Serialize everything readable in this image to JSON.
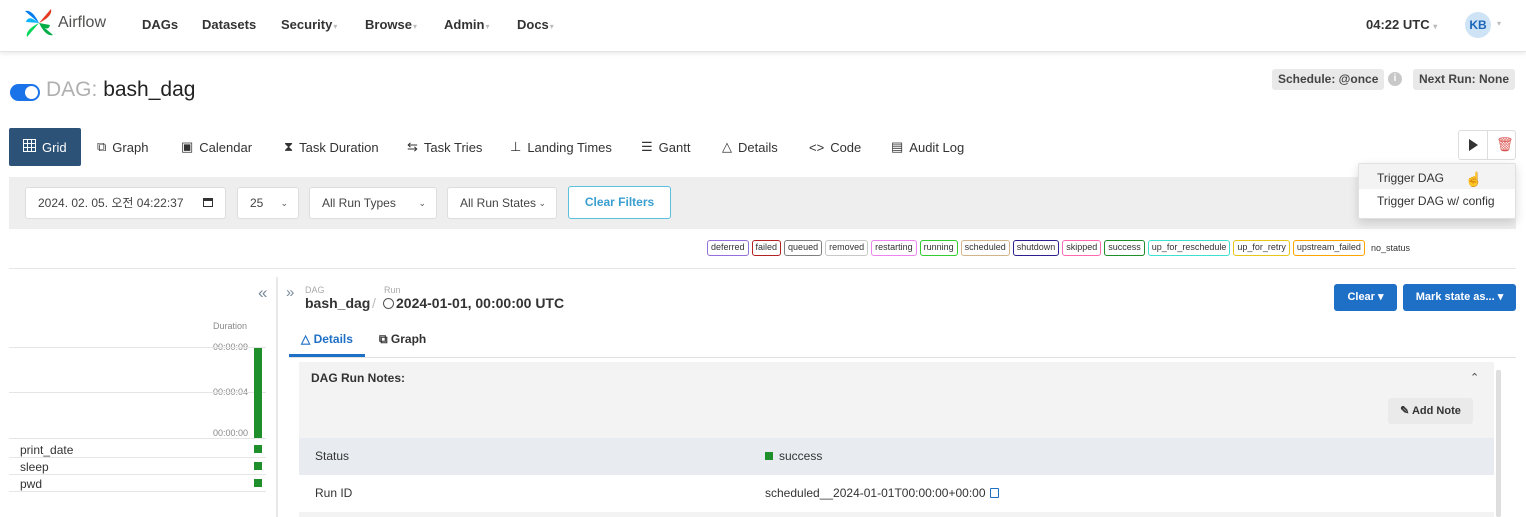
{
  "nav": {
    "brand": "Airflow",
    "items": [
      {
        "label": "DAGs",
        "dropdown": false
      },
      {
        "label": "Datasets",
        "dropdown": false
      },
      {
        "label": "Security",
        "dropdown": true
      },
      {
        "label": "Browse",
        "dropdown": true
      },
      {
        "label": "Admin",
        "dropdown": true
      },
      {
        "label": "Docs",
        "dropdown": true
      }
    ],
    "time": "04:22 UTC",
    "avatar": "KB"
  },
  "dag": {
    "prefix": "DAG:",
    "name": "bash_dag",
    "paused": false,
    "schedule": "Schedule: @once",
    "next_run": "Next Run: None"
  },
  "tabs": [
    {
      "label": "Grid",
      "icon": "grid-icon"
    },
    {
      "label": "Graph",
      "icon": "graph-icon"
    },
    {
      "label": "Calendar",
      "icon": "calendar-icon"
    },
    {
      "label": "Task Duration",
      "icon": "hourglass-icon"
    },
    {
      "label": "Task Tries",
      "icon": "retry-icon"
    },
    {
      "label": "Landing Times",
      "icon": "plane-landing-icon"
    },
    {
      "label": "Gantt",
      "icon": "gantt-icon"
    },
    {
      "label": "Details",
      "icon": "warning-triangle-icon"
    },
    {
      "label": "Code",
      "icon": "code-icon"
    },
    {
      "label": "Audit Log",
      "icon": "document-icon"
    }
  ],
  "trigger_menu": {
    "items": [
      "Trigger DAG",
      "Trigger DAG w/ config"
    ]
  },
  "filters": {
    "base_date": "2024. 02. 05. 오전 04:22:37",
    "num_runs": "25",
    "run_type": "All Run Types",
    "run_state": "All Run States",
    "clear_label": "Clear Filters"
  },
  "legend": [
    {
      "label": "deferred",
      "color": "#9370db"
    },
    {
      "label": "failed",
      "color": "#b22222"
    },
    {
      "label": "queued",
      "color": "#808080"
    },
    {
      "label": "removed",
      "color": "#c8c8c8"
    },
    {
      "label": "restarting",
      "color": "#ee82ee"
    },
    {
      "label": "running",
      "color": "#32cd32"
    },
    {
      "label": "scheduled",
      "color": "#d2b48c"
    },
    {
      "label": "shutdown",
      "color": "#2d1f8f"
    },
    {
      "label": "skipped",
      "color": "#ff69b4"
    },
    {
      "label": "success",
      "color": "#1e8f2a"
    },
    {
      "label": "up_for_reschedule",
      "color": "#40e0d0"
    },
    {
      "label": "up_for_retry",
      "color": "#e6c619"
    },
    {
      "label": "upstream_failed",
      "color": "#ffa500"
    }
  ],
  "legend_plain": "no_status",
  "grid": {
    "duration_label": "Duration",
    "ticks": [
      "00:00:09",
      "00:00:04",
      "00:00:00"
    ],
    "tasks": [
      "print_date",
      "sleep",
      "pwd"
    ]
  },
  "details": {
    "bc_dag_small": "DAG",
    "bc_dag": "bash_dag",
    "bc_sep": "/",
    "bc_run_small": "Run",
    "bc_run": "2024-01-01, 00:00:00 UTC",
    "clear_btn": "Clear",
    "mark_btn": "Mark state as...",
    "subtab_details": "Details",
    "subtab_graph": "Graph",
    "notes_title": "DAG Run Notes:",
    "add_note": "Add Note",
    "rows": [
      {
        "label": "Status",
        "value": "success"
      },
      {
        "label": "Run ID",
        "value": "scheduled__2024-01-01T00:00:00+00:00"
      }
    ]
  }
}
